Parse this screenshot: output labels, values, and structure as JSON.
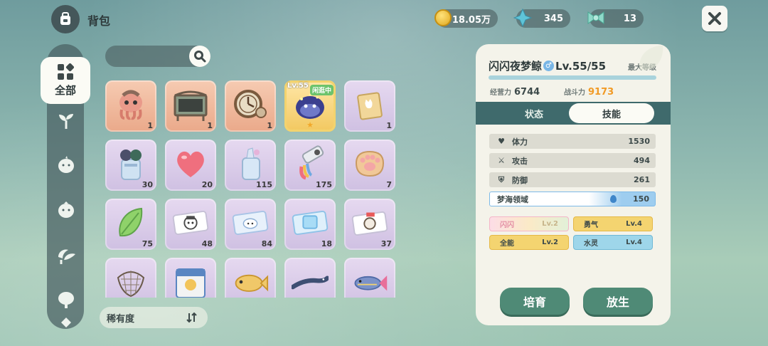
{
  "header": {
    "title": "背包",
    "icon": "backpack-icon"
  },
  "resources": {
    "gold": "18.05万",
    "crystal": "345",
    "ribbon": "13"
  },
  "sidebar": {
    "active_label": "全部",
    "items": [
      "sprout-icon",
      "bird-icon",
      "bird-alt-icon",
      "mushroom-icon",
      "tree-icon"
    ]
  },
  "search": {
    "placeholder": ""
  },
  "grid": {
    "items": [
      {
        "name": "octopus-item",
        "qty": "1",
        "color": "orange"
      },
      {
        "name": "signboard-item",
        "qty": "1",
        "color": "orange"
      },
      {
        "name": "clock-item",
        "qty": "1",
        "color": "orange"
      },
      {
        "name": "whale-pet",
        "qty": "",
        "color": "gold",
        "level": "Lv.55",
        "tag": "闲逛中"
      },
      {
        "name": "cat-box-item",
        "qty": "1",
        "color": "purple"
      },
      {
        "name": "potion-jar-item",
        "qty": "30",
        "color": "purple"
      },
      {
        "name": "heart-jelly-item",
        "qty": "20",
        "color": "purple"
      },
      {
        "name": "crystal-jar-item",
        "qty": "115",
        "color": "purple"
      },
      {
        "name": "paint-tube-item",
        "qty": "175",
        "color": "purple"
      },
      {
        "name": "paw-cookie-item",
        "qty": "7",
        "color": "purple"
      },
      {
        "name": "leaf-item",
        "qty": "75",
        "color": "purple"
      },
      {
        "name": "ticket-ghost-item",
        "qty": "48",
        "color": "purple"
      },
      {
        "name": "ticket-cloud-item",
        "qty": "84",
        "color": "purple"
      },
      {
        "name": "ticket-ice-item",
        "qty": "18",
        "color": "purple"
      },
      {
        "name": "ticket-mouse-item",
        "qty": "37",
        "color": "purple"
      },
      {
        "name": "net-item",
        "qty": "",
        "color": "purple"
      },
      {
        "name": "card-item",
        "qty": "",
        "color": "purple"
      },
      {
        "name": "golden-fish-item",
        "qty": "",
        "color": "purple"
      },
      {
        "name": "eel-item",
        "qty": "",
        "color": "purple"
      },
      {
        "name": "tuna-item",
        "qty": "",
        "color": "purple"
      }
    ]
  },
  "sort": {
    "label": "稀有度"
  },
  "pet": {
    "name": "闪闪夜梦鲸",
    "gender": "♂",
    "level": "Lv.55/55",
    "max_label": "最大等级",
    "manage_label": "经营力",
    "manage_value": "6744",
    "power_label": "战斗力",
    "power_value": "9173",
    "tabs": [
      "状态",
      "技能"
    ],
    "active_tab": 1,
    "stats": [
      {
        "label": "体力",
        "value": "1530",
        "icon": "heart-icon"
      },
      {
        "label": "攻击",
        "value": "494",
        "icon": "sword-icon"
      },
      {
        "label": "防御",
        "value": "261",
        "icon": "shield-icon"
      },
      {
        "label": "梦海领域",
        "value": "150",
        "icon": "water-drop-icon"
      }
    ],
    "traits": [
      {
        "label": "闪闪",
        "lv": "Lv.2"
      },
      {
        "label": "勇气",
        "lv": "Lv.4"
      },
      {
        "label": "全能",
        "lv": "Lv.2"
      },
      {
        "label": "水灵",
        "lv": "Lv.4"
      }
    ],
    "btn_train": "培育",
    "btn_release": "放生"
  },
  "colors": {
    "accent_green": "#4f8a76",
    "power_orange": "#f19a25",
    "tab_bar": "#3f6a6c"
  }
}
